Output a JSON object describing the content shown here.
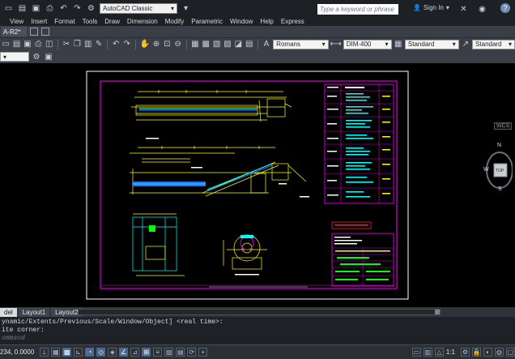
{
  "app": {
    "workspace": "AutoCAD Classic",
    "search_placeholder": "Type a keyword or phrase",
    "signin": "Sign In",
    "help": "?"
  },
  "menu": [
    "View",
    "Insert",
    "Format",
    "Tools",
    "Draw",
    "Dimension",
    "Modify",
    "Parametric",
    "Window",
    "Help",
    "Express"
  ],
  "file_tab": "A-R2*",
  "toolbar": {
    "text_style": "Romans",
    "dim_style": "DIM-400",
    "table_style": "Standard",
    "multileader_style": "Standard"
  },
  "layout_tabs": [
    "del",
    "Layout1",
    "Layout2"
  ],
  "command": {
    "line1": "ynamic/Extents/Previous/Scale/Window/Object] <real time>:",
    "line2": "ite corner:",
    "input_placeholder": "ommand"
  },
  "status": {
    "coords": "234, 0.0000",
    "scale": "1:1"
  },
  "viewcube": {
    "north": "N",
    "south": "S",
    "west": "W",
    "top": "TOP",
    "wcs": "WCS"
  },
  "colors": {
    "background": "#000000",
    "drawing_yellow": "#ffff00",
    "drawing_magenta": "#ff00ff",
    "drawing_cyan": "#00ffff",
    "drawing_green": "#00ff00",
    "drawing_blue": "#2d6bff",
    "drawing_red": "#ff2020"
  }
}
